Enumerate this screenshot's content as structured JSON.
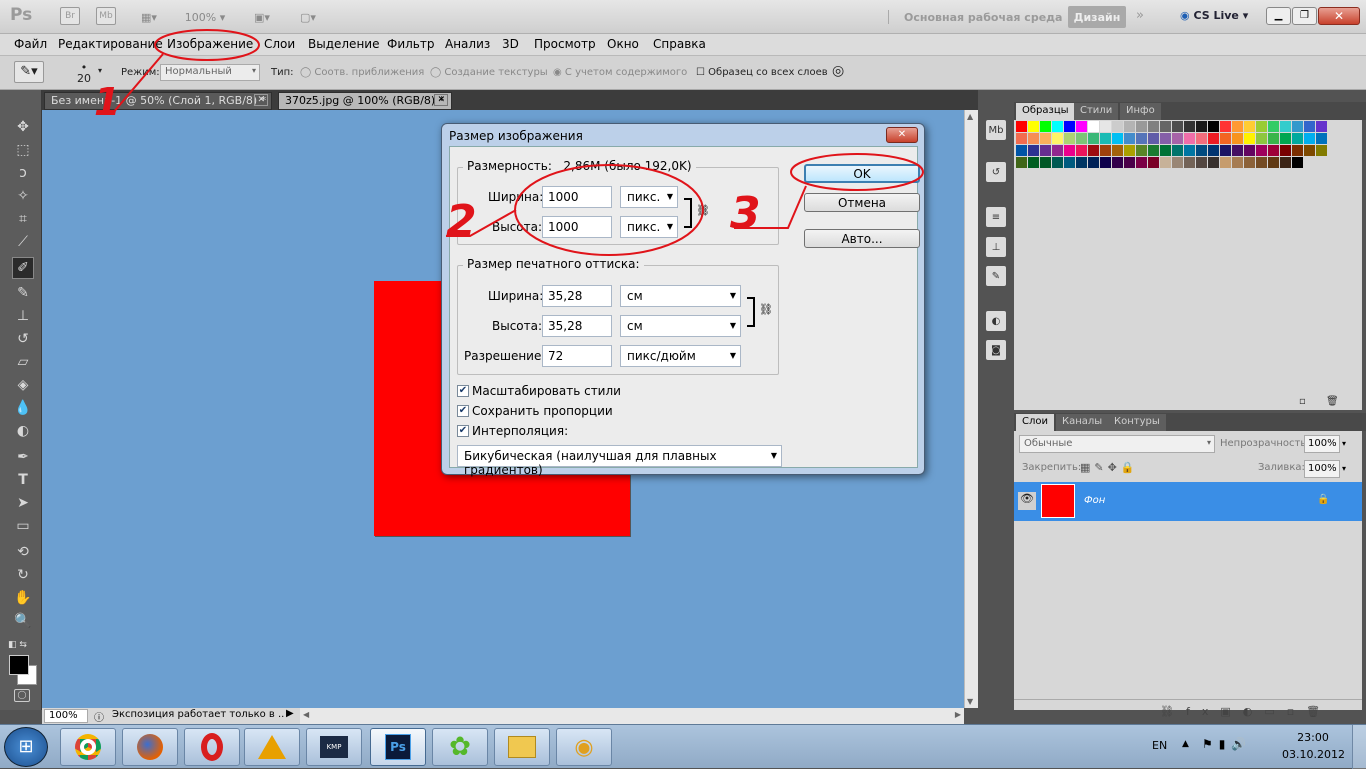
{
  "app": {
    "logo": "Ps",
    "zoom": "100%",
    "workspace": "Основная рабочая среда",
    "design_btn": "Дизайн",
    "cslive": "CS Live"
  },
  "menu": [
    "Файл",
    "Редактирование",
    "Изображение",
    "Слои",
    "Выделение",
    "Фильтр",
    "Анализ",
    "3D",
    "Просмотр",
    "Окно",
    "Справка"
  ],
  "options": {
    "brush_size": "20",
    "mode_label": "Режим:",
    "mode_value": "Нормальный",
    "type_label": "Тип:",
    "radio1": "Соотв. приближения",
    "radio2": "Создание текстуры",
    "radio3": "С учетом содержимого",
    "sample_all": "Образец со всех слоев"
  },
  "tabs": [
    "Без имени-1 @ 50% (Слой 1, RGB/8) *",
    "370z5.jpg @ 100% (RGB/8) *"
  ],
  "status": {
    "zoom": "100%",
    "text": "Экспозиция работает только в ..."
  },
  "dialog": {
    "title": "Размер изображения",
    "pixel_dims_label": "Размерность:",
    "pixel_dims_value": "2,86M (было 192,0K)",
    "width_label": "Ширина:",
    "width_value": "1000",
    "width_unit": "пикс.",
    "height_label": "Высота:",
    "height_value": "1000",
    "height_unit": "пикс.",
    "print_group": "Размер печатного оттиска:",
    "pwidth_label": "Ширина:",
    "pwidth_value": "35,28",
    "pwidth_unit": "см",
    "pheight_label": "Высота:",
    "pheight_value": "35,28",
    "pheight_unit": "см",
    "res_label": "Разрешение:",
    "res_value": "72",
    "res_unit": "пикс/дюйм",
    "scale_styles": "Масштабировать стили",
    "constrain": "Сохранить пропорции",
    "resample": "Интерполяция:",
    "resample_value": "Бикубическая (наилучшая для плавных градиентов)",
    "ok": "OK",
    "cancel": "Отмена",
    "auto": "Авто..."
  },
  "swatches_panel": {
    "tabs": [
      "Образцы",
      "Стили",
      "Инфо"
    ]
  },
  "layers_panel": {
    "tabs": [
      "Слои",
      "Каналы",
      "Контуры"
    ],
    "blend": "Обычные",
    "opacity_label": "Непрозрачность:",
    "opacity": "100%",
    "lock_label": "Закрепить:",
    "fill_label": "Заливка:",
    "fill": "100%",
    "layer_name": "Фон"
  },
  "annotations": [
    "1",
    "2",
    "3"
  ],
  "taskbar": {
    "lang": "EN",
    "time": "23:00",
    "date": "03.10.2012"
  },
  "colors": {
    "canvas": "#6c9fd0",
    "red": "#ff0000",
    "annotation": "#e0141a",
    "layer_sel": "#3a8ee6"
  }
}
